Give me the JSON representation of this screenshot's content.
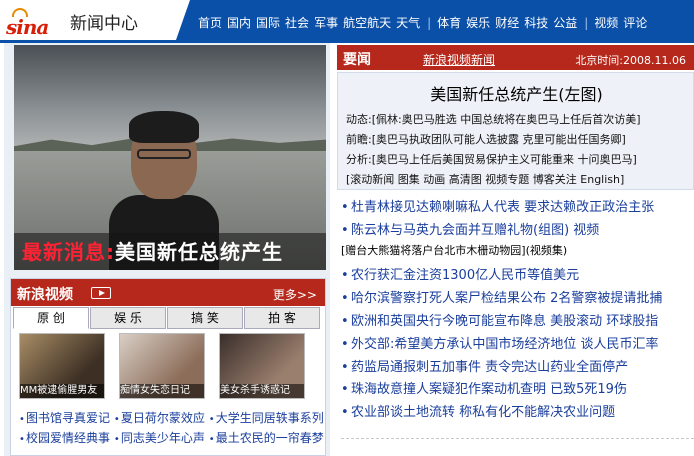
{
  "brand": {
    "logo": "sina",
    "site": "新闻中心"
  },
  "nav": {
    "group1": [
      "首页",
      "国内",
      "国际",
      "社会",
      "军事",
      "航空航天",
      "天气"
    ],
    "group2": [
      "体育",
      "娱乐",
      "财经",
      "科技",
      "公益"
    ],
    "group3": [
      "视频",
      "评论"
    ]
  },
  "photo": {
    "caption_red": "最新消息:",
    "caption_white": "美国新任总统产生"
  },
  "video": {
    "title": "新浪视频",
    "more": "更多>>",
    "tabs": [
      "原 创",
      "娱 乐",
      "搞 笑",
      "拍 客"
    ],
    "thumbs": [
      "MM被逮偷腥男友",
      "痴情女失恋日记",
      "美女杀手诱惑记"
    ],
    "links": [
      [
        "图书馆寻真爱记",
        "夏日荷尔蒙效应",
        "大学生同居轶事系列"
      ],
      [
        "校园爱情经典事",
        "同志美少年心声",
        "最土农民的一帘春梦"
      ]
    ]
  },
  "news": {
    "section": "要闻",
    "video_link": "新浪视频新闻",
    "time": "北京时间:2008.11.06",
    "headline": "美国新任总统产生(左图)",
    "dynamics_label": "动态:",
    "dynamics": "[佩林:奥巴马胜选 中国总统将在奥巴马上任后首次访美]",
    "previous_label": "前瞻:",
    "previous": "[奥巴马执政团队可能人选披露 克里可能出任国务卿]",
    "analysis_label": "分析:",
    "analysis": "[奥巴马上任后美国贸易保护主义可能重来 十问奥巴马]",
    "extra": "[滚动新闻 图集 动画 高清图 视频专题 博客关注 English]",
    "items": [
      "杜青林接见达赖喇嘛私人代表 要求达赖改正政治主张",
      "陈云林与马英九会面并互赠礼物(组图) 视频",
      "[赠台大熊猫将落户台北市木栅动物园](视频集)",
      "农行获汇金注资1300亿人民币等值美元",
      "哈尔滨警察打死人案尸检结果公布 2名警察被提请批捕",
      "欧洲和英国央行今晚可能宣布降息 美股滚动 环球股指",
      "外交部:希望美方承认中国市场经济地位 谈人民币汇率",
      "药监局通报刺五加事件 责令完达山药业全面停产",
      "珠海故意撞人案疑犯作案动机查明 已致5死19伤",
      "农业部谈土地流转 称私有化不能解决农业问题"
    ]
  }
}
